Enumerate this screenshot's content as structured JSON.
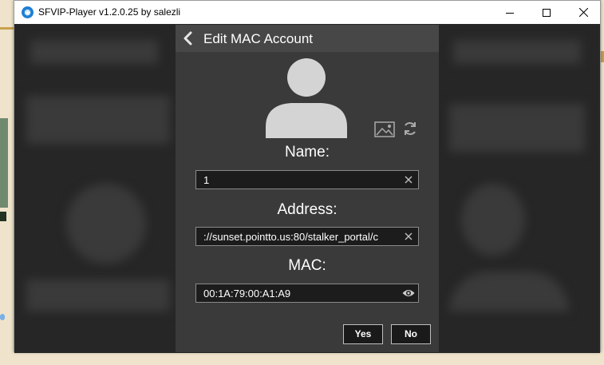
{
  "window": {
    "title": "SFVIP-Player v1.2.0.25 by salezli",
    "minimize_icon": "minimize-icon",
    "maximize_icon": "maximize-icon",
    "close_icon": "close-icon"
  },
  "dialog": {
    "title": "Edit MAC Account",
    "back_icon": "chevron-left-icon",
    "avatar_icon": "user-avatar-icon",
    "image_icon": "image-icon",
    "refresh_icon": "refresh-icon",
    "name": {
      "label": "Name:",
      "value": "1",
      "action_icon": "clear-icon"
    },
    "address": {
      "label": "Address:",
      "value": "://sunset.pointto.us:80/stalker_portal/c",
      "action_icon": "clear-icon"
    },
    "mac": {
      "label": "MAC:",
      "value": "00:1A:79:00:A1:A9",
      "action_icon": "eye-icon"
    },
    "yes_label": "Yes",
    "no_label": "No"
  },
  "colors": {
    "window_bg": "#2c2c2c",
    "dialog_bg": "#3a3a3a",
    "header_bg": "#474747",
    "field_bg": "#1c1c1c"
  }
}
